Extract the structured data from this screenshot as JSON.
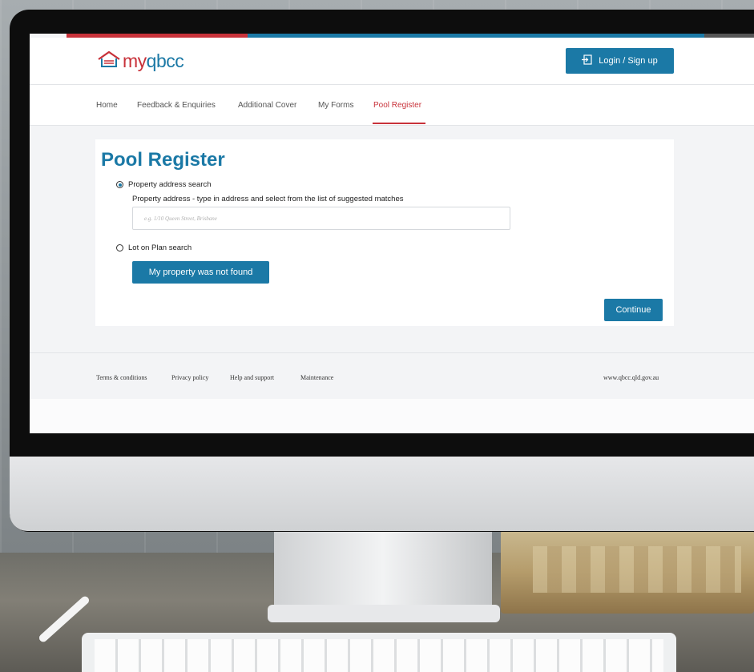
{
  "header": {
    "logo_my": "my",
    "logo_rest": "qbcc",
    "login_label": "Login / Sign up"
  },
  "nav": {
    "items": [
      {
        "label": "Home"
      },
      {
        "label": "Feedback & Enquiries"
      },
      {
        "label": "Additional Cover"
      },
      {
        "label": "My Forms"
      },
      {
        "label": "Pool Register"
      }
    ],
    "active": "Pool Register"
  },
  "main": {
    "title": "Pool Register",
    "option_address": "Property address search",
    "option_address_selected": true,
    "address_label": "Property address - type in address and select from the list of suggested matches",
    "address_placeholder": "e.g. 1/10 Queen Street, Brisbane",
    "address_value": "",
    "option_lot": "Lot on Plan search",
    "option_lot_selected": false,
    "not_found_label": "My property was not found",
    "continue_label": "Continue"
  },
  "footer": {
    "links": [
      {
        "label": "Terms & conditions"
      },
      {
        "label": "Privacy policy"
      },
      {
        "label": "Help and support"
      },
      {
        "label": "Maintenance"
      }
    ],
    "site": "www.qbcc.qld.gov.au"
  },
  "colors": {
    "brand_blue": "#1b79a6",
    "brand_red": "#c8323a"
  },
  "icons": {
    "logo": "house-icon",
    "login": "login-icon"
  }
}
